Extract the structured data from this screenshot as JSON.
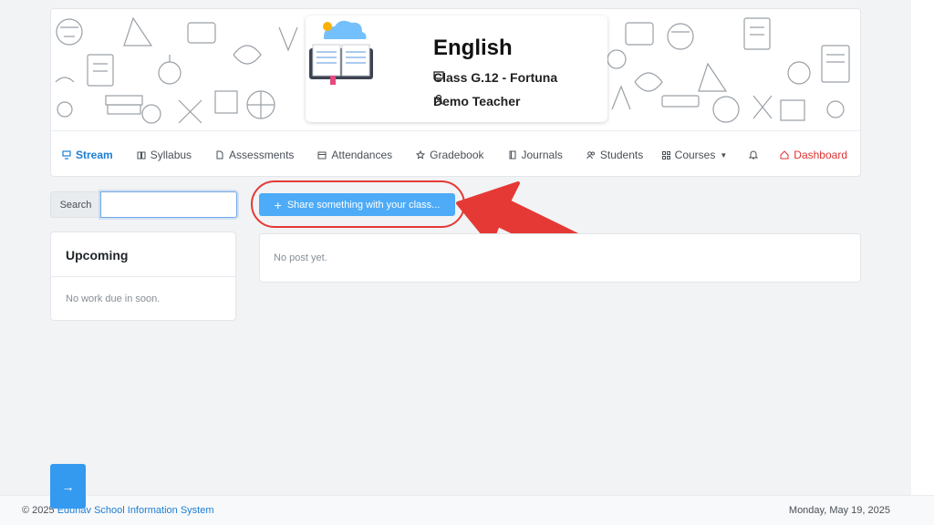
{
  "course": {
    "title": "English",
    "class_label": "Class G.12 - Fortuna",
    "teacher": "Demo Teacher"
  },
  "tabs": [
    {
      "label": "Stream",
      "icon": "stream-icon",
      "active": true
    },
    {
      "label": "Syllabus",
      "icon": "book-open-icon"
    },
    {
      "label": "Assessments",
      "icon": "file-icon"
    },
    {
      "label": "Attendances",
      "icon": "calendar-icon"
    },
    {
      "label": "Gradebook",
      "icon": "star-icon"
    },
    {
      "label": "Journals",
      "icon": "journal-icon"
    },
    {
      "label": "Students",
      "icon": "users-icon"
    }
  ],
  "nav_right": {
    "courses_label": "Courses",
    "dashboard_label": "Dashboard"
  },
  "search": {
    "label": "Search",
    "value": ""
  },
  "upcoming": {
    "title": "Upcoming",
    "empty_text": "No work due in soon."
  },
  "share_button_label": "Share something with your class...",
  "posts": {
    "empty_text": "No post yet."
  },
  "footer": {
    "copyright_prefix": "© 2025",
    "system_name": "Edunav School Information System",
    "date": "Monday, May 19, 2025"
  },
  "next_button_icon": "arrow-right-icon",
  "colors": {
    "accent": "#1c7ed6",
    "share_button": "#4dabf7",
    "highlight_red": "#e53935",
    "dashboard_red": "#e03131"
  }
}
